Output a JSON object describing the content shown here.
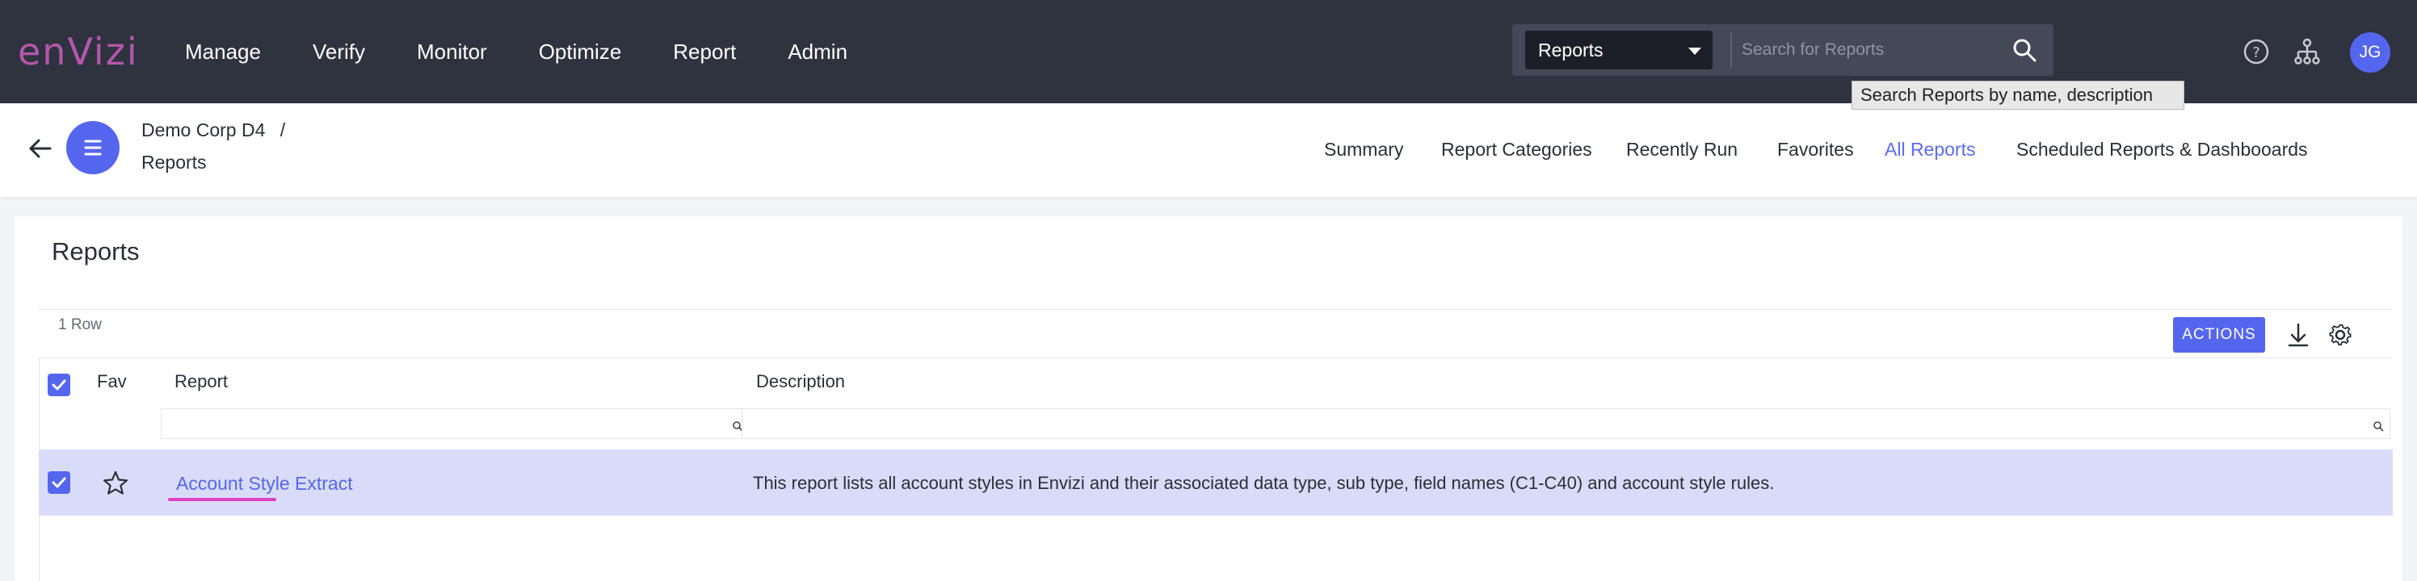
{
  "brand": {
    "logo_text": "enVizi",
    "logo_color": "#b357a9",
    "accent": "#5566ee"
  },
  "nav": {
    "items": [
      "Manage",
      "Verify",
      "Monitor",
      "Optimize",
      "Report",
      "Admin"
    ]
  },
  "search": {
    "scope_value": "Reports",
    "placeholder": "Search for Reports",
    "tooltip": "Search Reports by name, description"
  },
  "header_icons": [
    "help-icon",
    "org-hierarchy-icon"
  ],
  "user": {
    "initials": "JG"
  },
  "breadcrumb": {
    "parent": "Demo Corp D4",
    "separator": "/",
    "current": "Reports"
  },
  "tabs": [
    {
      "label": "Summary",
      "active": false
    },
    {
      "label": "Report Categories",
      "active": false
    },
    {
      "label": "Recently Run",
      "active": false
    },
    {
      "label": "Favorites",
      "active": false
    },
    {
      "label": "All Reports",
      "active": true
    },
    {
      "label": "Scheduled Reports & Dashbooards",
      "active": false
    }
  ],
  "page": {
    "title": "Reports"
  },
  "grid": {
    "row_count": "1 Row",
    "actions_label": "ACTIONS",
    "columns": {
      "fav": "Fav",
      "report": "Report",
      "description": "Description"
    },
    "rows": [
      {
        "selected": true,
        "favorite": false,
        "report": "Account Style Extract",
        "description": "This report lists all account styles in Envizi and their associated data type, sub type, field names (C1-C40) and account style rules."
      }
    ]
  }
}
